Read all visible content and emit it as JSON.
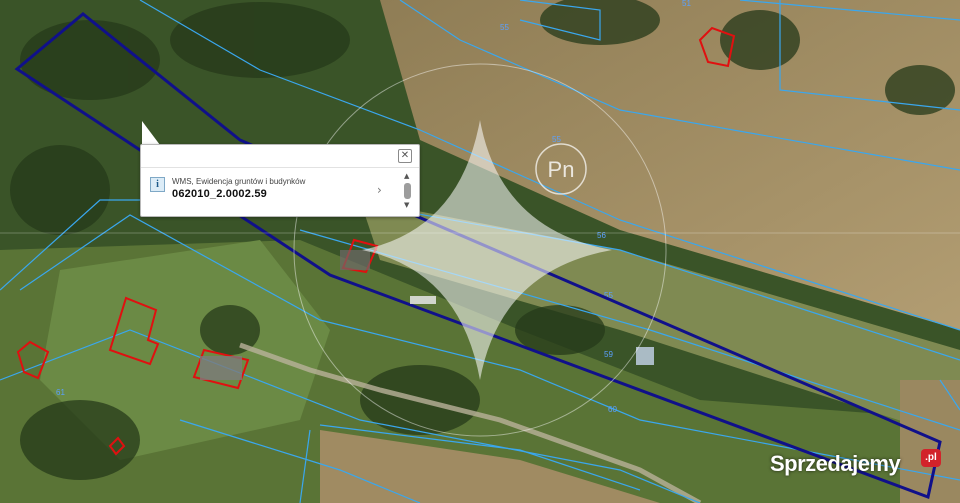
{
  "map": {
    "colors": {
      "forest": "#2f4a22",
      "meadow": "#5d7a3a",
      "field": "#a08b62",
      "parcel_border": "#3aa7ee",
      "selected_parcel": "#10108a",
      "building": "#e01010",
      "compass": "#ffffff"
    },
    "compass_label": "Pn",
    "parcel_labels": [
      "51",
      "55",
      "55",
      "55",
      "56",
      "59",
      "60",
      "61"
    ]
  },
  "popup": {
    "layer_name": "WMS, Ewidencja gruntów i budynków",
    "parcel_id": "062010_2.0002.59",
    "close_icon": "close-icon",
    "info_icon": "info-icon",
    "next_icon": "chevron-right-icon",
    "close_glyph": "✕",
    "info_glyph": "i",
    "next_glyph": "›",
    "scroll_up_glyph": "▲",
    "scroll_down_glyph": "▼"
  },
  "watermark": {
    "brand": "Sprzedajemy",
    "suffix": ".pl"
  }
}
